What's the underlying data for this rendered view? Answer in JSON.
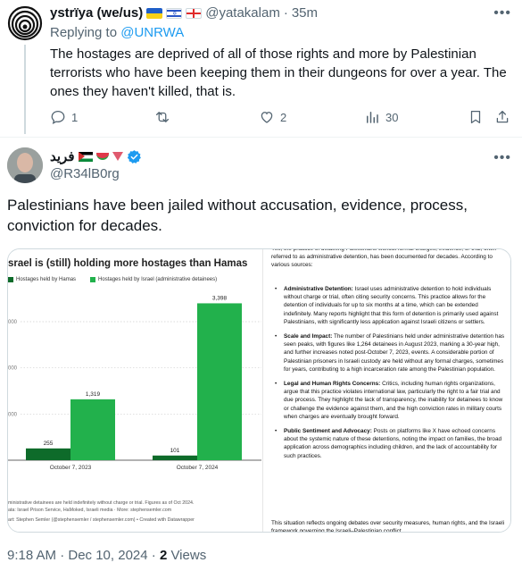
{
  "reply_tweet": {
    "display_name": "ystrïya (we/us)",
    "handle": "@yatakalam",
    "separator": "·",
    "time": "35m",
    "replying_label": "Replying to",
    "replying_to": "@UNRWA",
    "text": "The hostages are deprived of all of those rights and more by Palestinian terrorists who have been keeping them in their dungeons for over a year. The ones they haven't killed, that is.",
    "replies": "1",
    "retweets": "",
    "likes": "2",
    "views": "30"
  },
  "main_tweet": {
    "display_name": "فريد",
    "handle": "@R34lB0rg",
    "text": "Palestinians have been jailed without accusation, evidence, process, conviction for decades.",
    "timestamp": "9:18 AM · Dec 10, 2024 · ",
    "views_count": "2",
    "views_label": " Views"
  },
  "media": {
    "chart_data": {
      "type": "bar",
      "title": "srael is (still) holding more hostages than Hamas",
      "categories": [
        "October 7, 2023",
        "October 7, 2024"
      ],
      "series": [
        {
          "name": "Hostages held by Hamas",
          "values": [
            255,
            101
          ],
          "color": "#0e6b2a"
        },
        {
          "name": "Hostages held by Israel (administrative detainees)",
          "values": [
            1319,
            3398
          ],
          "color": "#22b14c"
        }
      ],
      "data_labels": [
        "255",
        "1,319",
        "101",
        "3,398"
      ],
      "y_tick_labels": [
        "000",
        "000",
        "000",
        "000"
      ],
      "ylim": [
        0,
        3600
      ],
      "grid": true,
      "legend_position": "top-left",
      "footnote_1": "ministrative detainees are held indefinitely without charge or trial. Figures as of Oct 2024.",
      "footnote_2": "ata: Israel Prison Service, HaMoked, Israeli media · More: stephensemler.com",
      "credit": "art: Stephen Semler (@stephensemler / stephensemler.com) • Created with Datawrapper"
    },
    "text_panel": {
      "intro": "Yes, the practice of detaining Palestinians without formal charges, evidence, or trial, often referred to as administrative detention, has been documented for decades. According to various sources:",
      "items": [
        {
          "heading": "Administrative Detention:",
          "body": " Israel uses administrative detention to hold individuals without charge or trial, often citing security concerns. This practice allows for the detention of individuals for up to six months at a time, which can be extended indefinitely. Many reports highlight that this form of detention is primarily used against Palestinians, with significantly less application against Israeli citizens or settlers."
        },
        {
          "heading": "Scale and Impact:",
          "body": " The number of Palestinians held under administrative detention has seen peaks, with figures like 1,264 detainees in August 2023, marking a 30-year high, and further increases noted post-October 7, 2023, events. A considerable portion of Palestinian prisoners in Israeli custody are held without any formal charges, sometimes for years, contributing to a high incarceration rate among the Palestinian population."
        },
        {
          "heading": "Legal and Human Rights Concerns:",
          "body": " Critics, including human rights organizations, argue that this practice violates international law, particularly the right to a fair trial and due process. They highlight the lack of transparency, the inability for detainees to know or challenge the evidence against them, and the high conviction rates in military courts when charges are eventually brought forward."
        },
        {
          "heading": "Public Sentiment and Advocacy:",
          "body": " Posts on platforms like X have echoed concerns about the systemic nature of these detentions, noting the impact on families, the broad application across demographics including children, and the lack of accountability for such practices."
        }
      ],
      "outro": "This situation reflects ongoing debates over security measures, human rights, and the Israeli framework governing the Israeli–Palestinian conflict."
    }
  }
}
